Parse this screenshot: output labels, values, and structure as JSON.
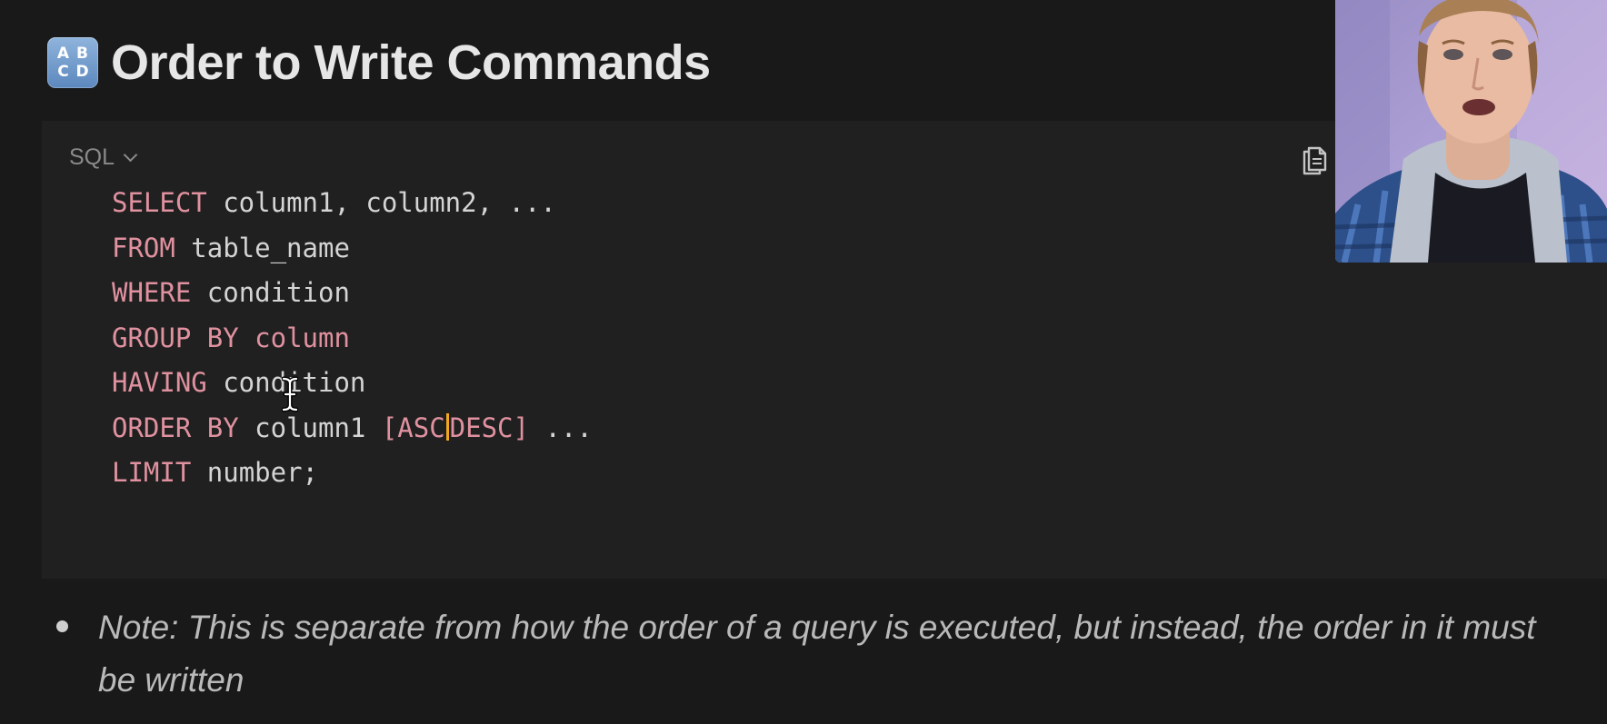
{
  "heading": {
    "icon_text": [
      "A",
      "B",
      "C",
      "D"
    ],
    "title": "Order to Write Commands"
  },
  "code_block": {
    "language": "SQL",
    "lines": [
      [
        {
          "t": "SELECT",
          "k": 1
        },
        {
          "t": " column1, column2, ...",
          "k": 0
        }
      ],
      [
        {
          "t": "FROM",
          "k": 1
        },
        {
          "t": " table_name",
          "k": 0
        }
      ],
      [
        {
          "t": "WHERE",
          "k": 1
        },
        {
          "t": " condition",
          "k": 0
        }
      ],
      [
        {
          "t": "GROUP BY",
          "k": 1
        },
        {
          "t": " column",
          "k": 1
        }
      ],
      [
        {
          "t": "HAVING",
          "k": 1
        },
        {
          "t": " condition",
          "k": 0
        }
      ],
      [
        {
          "t": "ORDER BY",
          "k": 1
        },
        {
          "t": " column1 ",
          "k": 0
        },
        {
          "t": "[ASC",
          "k": 1
        },
        {
          "t": "CARET",
          "k": 2
        },
        {
          "t": "DESC]",
          "k": 1
        },
        {
          "t": " ...",
          "k": 0
        }
      ],
      [
        {
          "t": "LIMIT",
          "k": 1
        },
        {
          "t": " number;",
          "k": 0
        }
      ]
    ]
  },
  "note": {
    "text": "Note: This is separate from how the order of a query is executed, but instead, the order in it must be written"
  },
  "colors": {
    "background": "#191919",
    "code_background": "#202020",
    "keyword": "#e0919f",
    "caret": "#f4a521"
  },
  "icons": {
    "heading_icon": "abcd-input-icon",
    "language_dropdown": "chevron-down-icon",
    "copy": "copy-icon",
    "pointer": "text-cursor-icon"
  }
}
